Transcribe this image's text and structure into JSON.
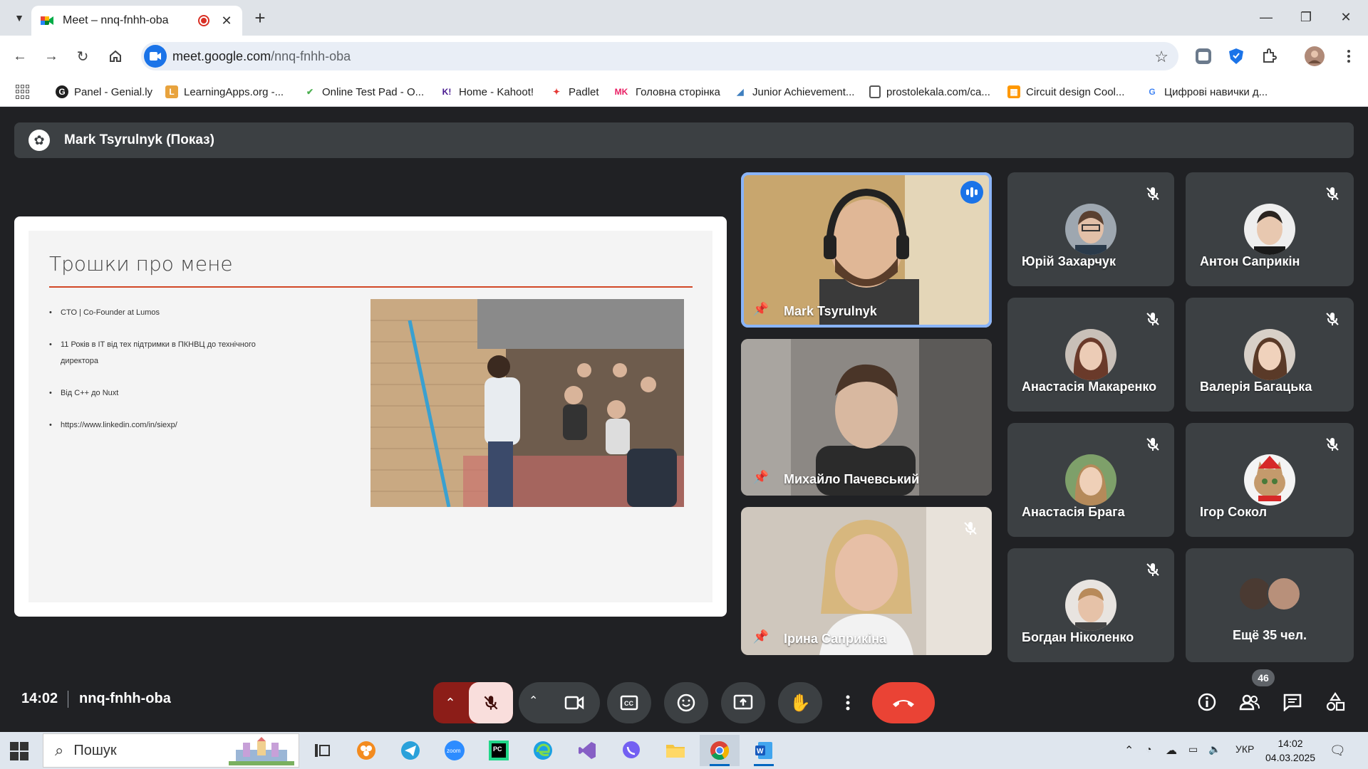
{
  "browser": {
    "tab_title": "Meet – nnq-fnhh-oba",
    "url_host": "meet.google.com",
    "url_path": "/nnq-fnhh-oba",
    "bookmarks": [
      {
        "label": "Panel - Genial.ly",
        "icon": "genially-icon",
        "color": "#1f1f1f"
      },
      {
        "label": "LearningApps.org -...",
        "icon": "learningapps-icon",
        "color": "#e8a33d"
      },
      {
        "label": "Online Test Pad - O...",
        "icon": "testpad-icon",
        "color": "#4caf50"
      },
      {
        "label": "Home - Kahoot!",
        "icon": "kahoot-icon",
        "color": "#46178f"
      },
      {
        "label": "Padlet",
        "icon": "padlet-icon",
        "color": "#e53935"
      },
      {
        "label": "Головна сторінка",
        "icon": "mk-icon",
        "color": "#e91e63"
      },
      {
        "label": "Junior Achievement...",
        "icon": "ja-icon",
        "color": "#3f7fbf"
      },
      {
        "label": "prostolekala.com/ca...",
        "icon": "page-icon",
        "color": "#555555"
      },
      {
        "label": "Circuit design Cool...",
        "icon": "circuit-icon",
        "color": "#ff9800"
      },
      {
        "label": "Цифрові навички д...",
        "icon": "google-icon",
        "color": "#4285f4"
      }
    ]
  },
  "meet": {
    "presenter_banner": "Mark Tsyrulnyk (Показ)",
    "slide": {
      "title": "Трошки про мене",
      "bullets": [
        "CTO | Co-Founder at Lumos",
        "11 Років в IT від тех підтримки в ПКНВЦ до технічного директора",
        "Від C++ до Nuxt",
        "https://www.linkedin.com/in/siexp/"
      ]
    },
    "video_tiles": [
      {
        "name": "Mark Tsyrulnyk"
      },
      {
        "name": "Михайло Пачевський"
      },
      {
        "name": "Ірина Саприкіна"
      }
    ],
    "participants": [
      {
        "name": "Юрій Захарчук"
      },
      {
        "name": "Антон Саприкін"
      },
      {
        "name": "Анастасія Макаренко"
      },
      {
        "name": "Валерія Багацька"
      },
      {
        "name": "Анастасія Брага"
      },
      {
        "name": "Ігор Сокол"
      },
      {
        "name": "Богдан Ніколенко"
      }
    ],
    "more_participants": "Ещё 35 чел.",
    "time": "14:02",
    "meeting_code": "nnq-fnhh-oba",
    "participant_count": "46",
    "colors": {
      "hangup": "#ea4335",
      "active_speaker": "#8ab4f8",
      "mic_off_bg": "#f9dedc"
    }
  },
  "taskbar": {
    "search_placeholder": "Пошук",
    "language": "УКР",
    "time": "14:02",
    "date": "04.03.2025"
  }
}
